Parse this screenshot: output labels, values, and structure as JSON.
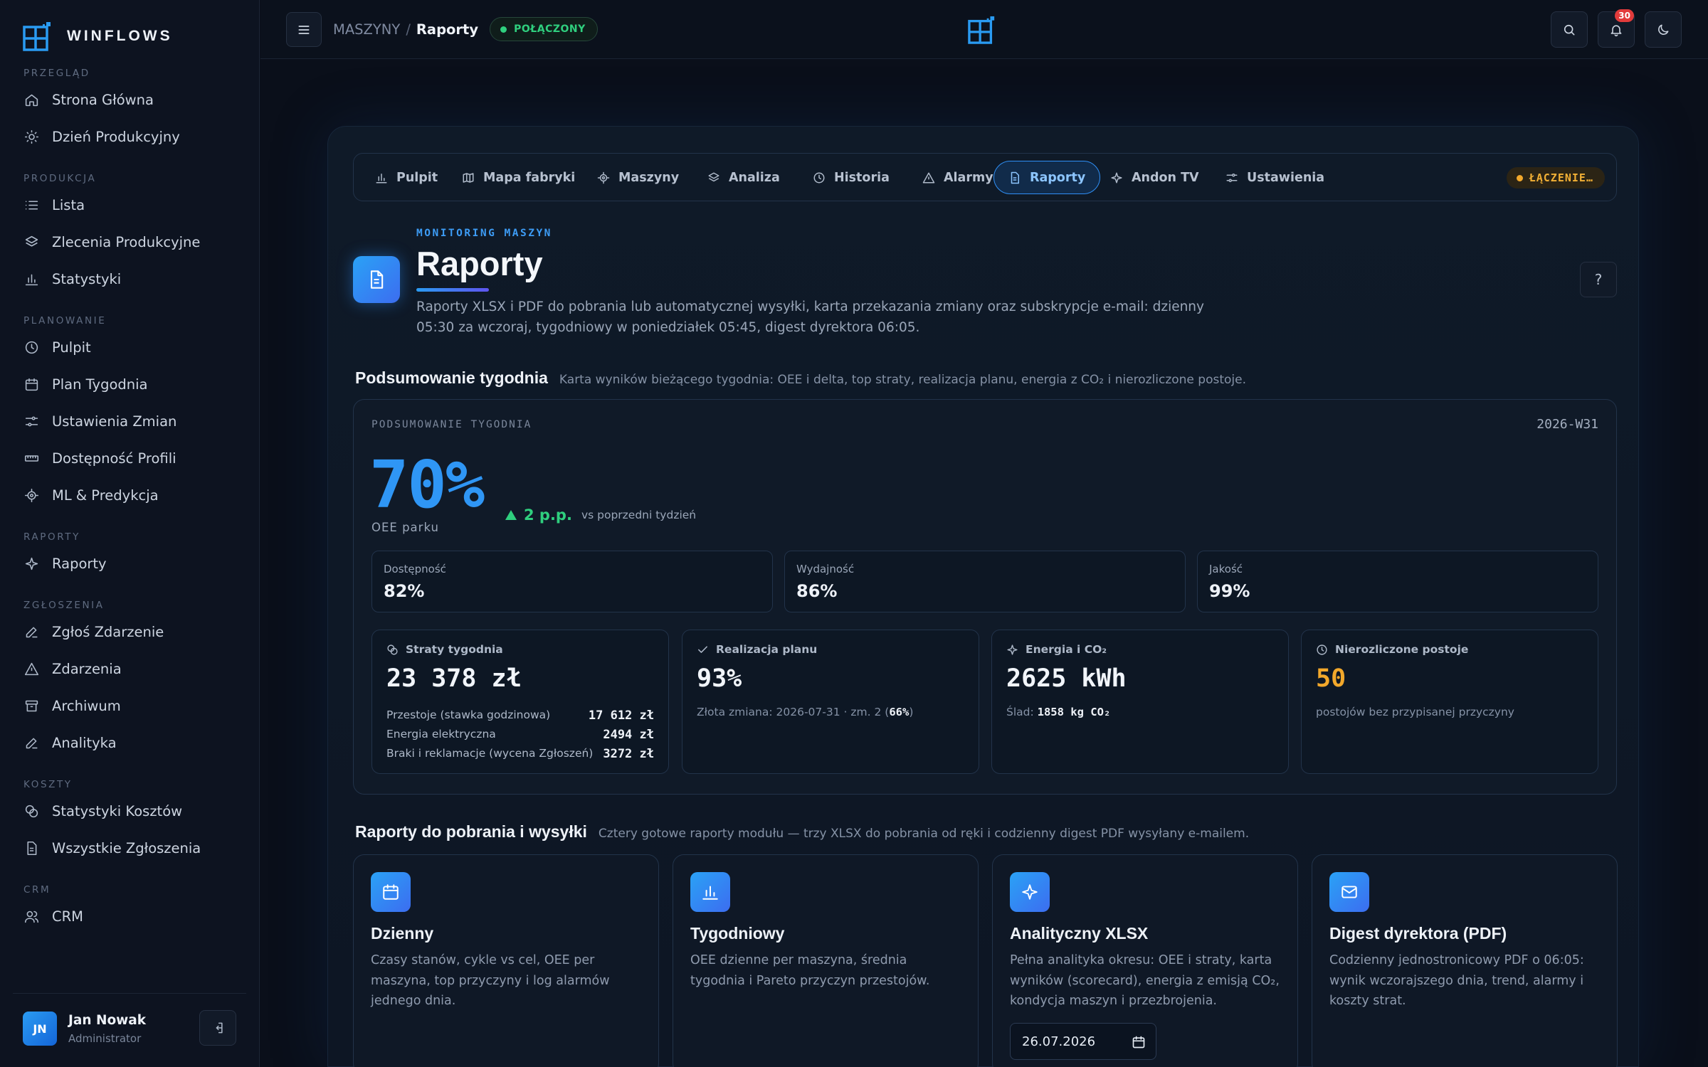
{
  "app": {
    "name": "WINFLOWS"
  },
  "sidebar": {
    "sections": [
      {
        "title": "PRZEGLĄD",
        "items": [
          "Strona Główna",
          "Dzień Produkcyjny"
        ]
      },
      {
        "title": "PRODUKCJA",
        "items": [
          "Lista",
          "Zlecenia Produkcyjne",
          "Statystyki"
        ]
      },
      {
        "title": "PLANOWANIE",
        "items": [
          "Pulpit",
          "Plan Tygodnia",
          "Ustawienia Zmian",
          "Dostępność Profili",
          "ML & Predykcja"
        ]
      },
      {
        "title": "RAPORTY",
        "items": [
          "Raporty"
        ]
      },
      {
        "title": "ZGŁOSZENIA",
        "items": [
          "Zgłoś Zdarzenie",
          "Zdarzenia",
          "Archiwum",
          "Analityka"
        ]
      },
      {
        "title": "KOSZTY",
        "items": [
          "Statystyki Kosztów",
          "Wszystkie Zgłoszenia"
        ]
      },
      {
        "title": "CRM",
        "items": [
          "CRM"
        ]
      }
    ],
    "user": {
      "initials": "JN",
      "name": "Jan Nowak",
      "role": "Administrator"
    }
  },
  "topbar": {
    "breadcrumb_parent": "MASZYNY",
    "breadcrumb_sep": "/",
    "breadcrumb_current": "Raporty",
    "connection": "POŁĄCZONY",
    "notifications": "30"
  },
  "tabs": {
    "items": [
      "Pulpit",
      "Mapa fabryki",
      "Maszyny",
      "Analiza",
      "Historia",
      "Alarmy",
      "Raporty",
      "Andon TV",
      "Ustawienia"
    ],
    "active": "Raporty",
    "status": "ŁĄCZENIE…"
  },
  "header": {
    "kicker": "MONITORING MASZYN",
    "title": "Raporty",
    "description": "Raporty XLSX i PDF do pobrania lub automatycznej wysyłki, karta przekazania zmiany oraz subskrypcje e-mail: dzienny 05:30 za wczoraj, tygodniowy w poniedziałek 05:45, digest dyrektora 06:05.",
    "help": "?"
  },
  "summary": {
    "section_title": "Podsumowanie tygodnia",
    "section_sub": "Karta wyników bieżącego tygodnia: OEE i delta, top straty, realizacja planu, energia z CO₂ i nierozliczone postoje.",
    "card_label": "PODSUMOWANIE TYGODNIA",
    "week": "2026-W31",
    "oee": "70%",
    "oee_caption": "OEE parku",
    "delta": "2 p.p.",
    "delta_note": "vs poprzedni tydzień",
    "metrics": [
      {
        "label": "Dostępność",
        "value": "82%"
      },
      {
        "label": "Wydajność",
        "value": "86%"
      },
      {
        "label": "Jakość",
        "value": "99%"
      }
    ],
    "losses": {
      "title": "Straty tygodnia",
      "value": "23 378 zł",
      "rows": [
        {
          "label": "Przestoje (stawka godzinowa)",
          "value": "17 612 zł"
        },
        {
          "label": "Energia elektryczna",
          "value": "2494 zł"
        },
        {
          "label": "Braki i reklamacje (wycena Zgłoszeń)",
          "value": "3272 zł"
        }
      ]
    },
    "plan": {
      "title": "Realizacja planu",
      "value": "93%",
      "note_prefix": "Złota zmiana: 2026-07-31 · zm. 2 (",
      "note_bold": "66%",
      "note_suffix": ")"
    },
    "energy": {
      "title": "Energia i CO₂",
      "value": "2625 kWh",
      "note_prefix": "Ślad: ",
      "note_bold": "1858 kg CO₂"
    },
    "downtime": {
      "title": "Nierozliczone postoje",
      "value": "50",
      "note": "postojów bez przypisanej przyczyny"
    }
  },
  "reports": {
    "section_title": "Raporty do pobrania i wysyłki",
    "section_sub": "Cztery gotowe raporty modułu — trzy XLSX do pobrania od ręki i codzienny digest PDF wysyłany e-mailem.",
    "cards": [
      {
        "title": "Dzienny",
        "desc": "Czasy stanów, cykle vs cel, OEE per maszyna, top przyczyny i log alarmów jednego dnia."
      },
      {
        "title": "Tygodniowy",
        "desc": "OEE dzienne per maszyna, średnia tygodnia i Pareto przyczyn przestojów."
      },
      {
        "title": "Analityczny XLSX",
        "desc": "Pełna analityka okresu: OEE i straty, karta wyników (scorecard), energia z emisją CO₂, kondycja maszyn i przezbrojenia.",
        "date": "26.07.2026"
      },
      {
        "title": "Digest dyrektora (PDF)",
        "desc": "Codzienny jednostronicowy PDF o 06:05: wynik wczorajszego dnia, trend, alarmy i koszty strat."
      }
    ]
  }
}
